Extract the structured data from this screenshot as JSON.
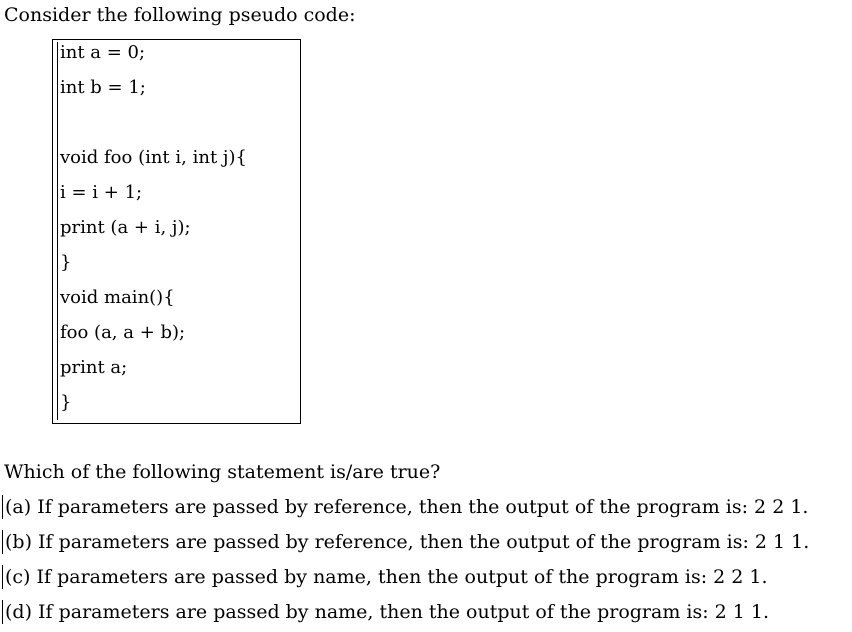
{
  "intro": "Consider the following pseudo code:",
  "code": [
    "int a = 0;",
    "int b = 1;",
    "",
    "void foo (int i, int j){",
    "i = i + 1;",
    "print (a + i, j);",
    "}",
    "void main(){",
    "foo (a, a + b);",
    "print a;",
    "}"
  ],
  "question": "Which of the following statement is/are true?",
  "options": [
    "(a) If parameters are passed by reference, then the output of the program is: 2 2 1.",
    "(b) If parameters are passed by reference, then the output of the program is: 2 1 1.",
    "(c) If parameters are passed by name, then the output of the program is: 2 2 1.",
    "(d) If parameters are passed by name, then the output of the program is: 2 1 1."
  ]
}
